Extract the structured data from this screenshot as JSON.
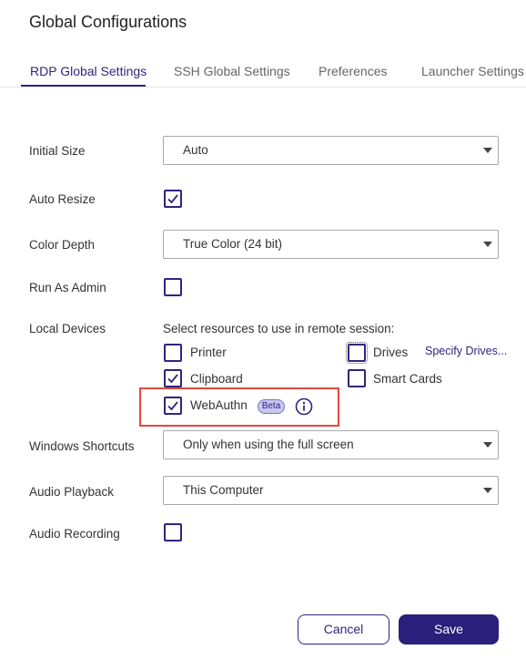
{
  "title": "Global Configurations",
  "tabs": [
    {
      "label": "RDP Global Settings",
      "active": true
    },
    {
      "label": "SSH Global Settings",
      "active": false
    },
    {
      "label": "Preferences",
      "active": false
    },
    {
      "label": "Launcher Settings",
      "active": false
    }
  ],
  "fields": {
    "initial_size": {
      "label": "Initial Size",
      "value": "Auto"
    },
    "auto_resize": {
      "label": "Auto Resize",
      "checked": true
    },
    "color_depth": {
      "label": "Color Depth",
      "value": "True Color (24 bit)"
    },
    "run_as_admin": {
      "label": "Run As Admin",
      "checked": false
    },
    "local_devices": {
      "label": "Local Devices",
      "hint": "Select resources to use in remote session:",
      "printer": {
        "label": "Printer",
        "checked": false
      },
      "drives": {
        "label": "Drives",
        "checked": false
      },
      "specify_drives": "Specify Drives...",
      "clipboard": {
        "label": "Clipboard",
        "checked": true
      },
      "smart_cards": {
        "label": "Smart Cards",
        "checked": false
      },
      "webauthn": {
        "label": "WebAuthn",
        "checked": true,
        "badge": "Beta"
      }
    },
    "windows_shortcuts": {
      "label": "Windows Shortcuts",
      "value": "Only when using the full screen"
    },
    "audio_playback": {
      "label": "Audio Playback",
      "value": "This Computer"
    },
    "audio_recording": {
      "label": "Audio Recording",
      "checked": false
    }
  },
  "buttons": {
    "cancel": "Cancel",
    "save": "Save"
  },
  "colors": {
    "accent": "#2f2580",
    "highlight": "#e5483f",
    "beta_bg": "#c9c6f0"
  }
}
